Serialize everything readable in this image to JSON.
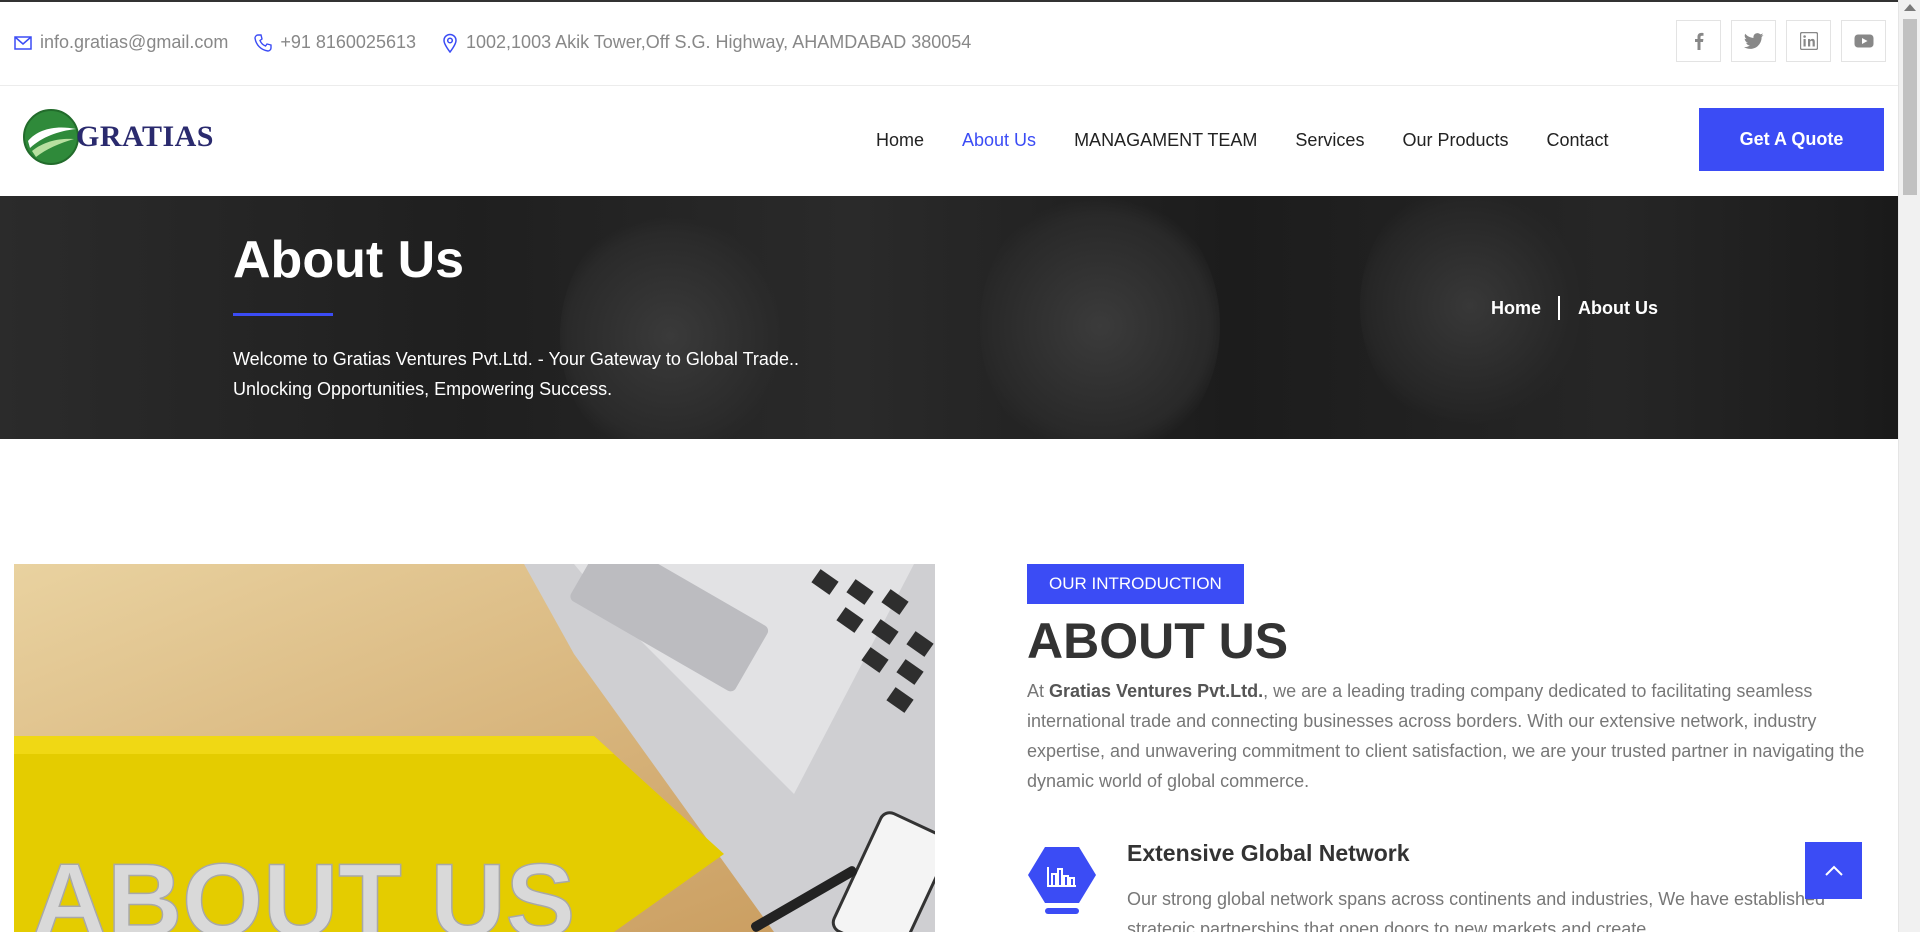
{
  "topbar": {
    "email": "info.gratias@gmail.com",
    "phone": "+91 8160025613",
    "address": "1002,1003 Akik Tower,Off S.G. Highway, AHAMDABAD 380054",
    "social": [
      "facebook-icon",
      "twitter-icon",
      "linkedin-icon",
      "youtube-icon"
    ]
  },
  "nav": {
    "logo_text": "GRATIAS",
    "items": [
      {
        "label": "Home",
        "active": false
      },
      {
        "label": "About Us",
        "active": true
      },
      {
        "label": "MANAGAMENT TEAM",
        "active": false
      },
      {
        "label": "Services",
        "active": false
      },
      {
        "label": "Our Products",
        "active": false
      },
      {
        "label": "Contact",
        "active": false
      }
    ],
    "cta": "Get A Quote"
  },
  "hero": {
    "title": "About Us",
    "subtitle_line1": "Welcome to Gratias Ventures Pvt.Ltd. - Your Gateway to Global Trade..",
    "subtitle_line2": "Unlocking Opportunities, Empowering Success.",
    "breadcrumb": [
      "Home",
      "About Us"
    ]
  },
  "about": {
    "image_text": "ABOUT US",
    "tag": "OUR INTRODUCTION",
    "heading": "ABOUT US",
    "para_prefix": "At ",
    "para_company": "Gratias Ventures Pvt.Ltd.",
    "para_rest": ", we are a leading trading company dedicated to facilitating seamless international trade and connecting businesses across borders. With our extensive network, industry expertise, and unwavering commitment to client satisfaction, we are your trusted partner in navigating the dynamic world of global commerce.",
    "feature_title": "Extensive Global Network",
    "feature_text": "Our strong global network spans across continents and industries, We have established strategic partnerships that open doors to new markets and create"
  },
  "colors": {
    "accent": "#3b4cf5",
    "text_dark": "#333333",
    "text_muted": "#777777"
  }
}
